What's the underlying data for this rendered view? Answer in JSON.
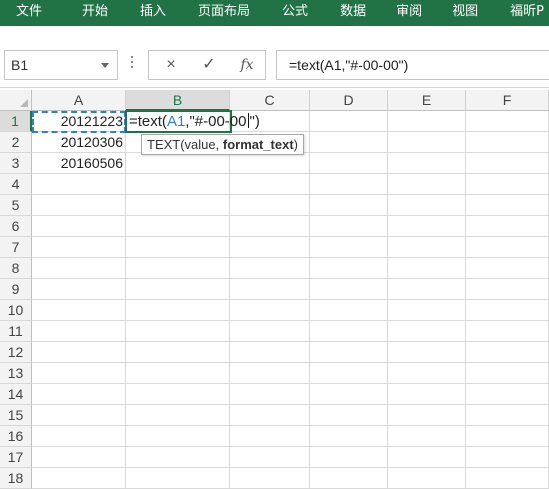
{
  "ribbon": {
    "tabs": [
      "文件",
      "开始",
      "插入",
      "页面布局",
      "公式",
      "数据",
      "审阅",
      "视图",
      "福昕P"
    ],
    "color": "#217346"
  },
  "name_box": {
    "value": "B1"
  },
  "formula_bar": {
    "cancel_icon": "×",
    "enter_icon": "✓",
    "fx_label": "fx",
    "value": "=text(A1,\"#-00-00\")"
  },
  "columns": [
    "A",
    "B",
    "C",
    "D",
    "E",
    "F"
  ],
  "rows": [
    "1",
    "2",
    "3",
    "4",
    "5",
    "6",
    "7",
    "8",
    "9",
    "10",
    "11",
    "12",
    "13",
    "14",
    "15",
    "16",
    "17",
    "18"
  ],
  "cells": {
    "A1": "20121223",
    "A2": "20120306",
    "A3": "20160506"
  },
  "editing": {
    "prefix": "=text(",
    "ref": "A1",
    "mid": ",\"#-00-00",
    "suffix": "\")"
  },
  "tooltip": {
    "func": "TEXT(value, ",
    "arg": "format_text",
    "close": ")"
  },
  "colors": {
    "accent": "#217346",
    "ref": "#2f7fd6"
  }
}
